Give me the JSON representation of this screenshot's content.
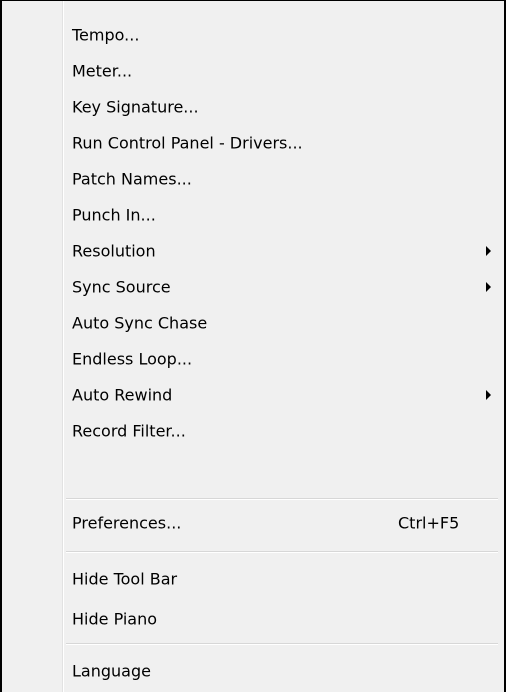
{
  "menu": {
    "items": [
      {
        "label": "Tempo..."
      },
      {
        "label": "Meter..."
      },
      {
        "label": "Key Signature..."
      },
      {
        "label": "Run Control Panel - Drivers..."
      },
      {
        "label": "Patch Names..."
      },
      {
        "label": "Punch In..."
      },
      {
        "label": "Resolution",
        "submenu": true
      },
      {
        "label": "Sync Source",
        "submenu": true
      },
      {
        "label": "Auto Sync Chase"
      },
      {
        "label": "Endless Loop..."
      },
      {
        "label": "Auto Rewind",
        "submenu": true
      },
      {
        "label": "Record Filter..."
      },
      {
        "label": "Preferences...",
        "shortcut": "Ctrl+F5"
      },
      {
        "label": "Hide Tool Bar"
      },
      {
        "label": "Hide Piano"
      },
      {
        "label": "Language"
      }
    ]
  }
}
